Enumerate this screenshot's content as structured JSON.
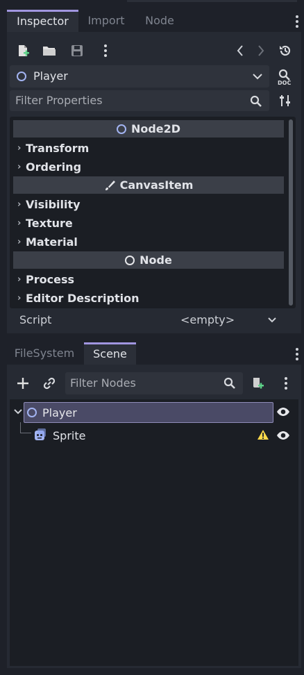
{
  "inspector": {
    "tabs": [
      "Inspector",
      "Import",
      "Node"
    ],
    "selected_node": "Player",
    "filter_placeholder": "Filter Properties",
    "sections": [
      {
        "title": "Node2D",
        "groups": [
          "Transform",
          "Ordering"
        ]
      },
      {
        "title": "CanvasItem",
        "groups": [
          "Visibility",
          "Texture",
          "Material"
        ]
      },
      {
        "title": "Node",
        "groups": [
          "Process",
          "Editor Description"
        ]
      }
    ],
    "script_label": "Script",
    "script_value": "<empty>"
  },
  "scene_dock": {
    "tabs": [
      "FileSystem",
      "Scene"
    ],
    "filter_placeholder": "Filter Nodes",
    "tree": [
      {
        "name": "Player",
        "selected": true
      },
      {
        "name": "Sprite",
        "warning": true
      }
    ]
  },
  "colors": {
    "accent": "#a196e0",
    "node2d_icon": "#a3b4f2",
    "warning": "#ffd94a",
    "selected_row": "#4a4a66"
  }
}
